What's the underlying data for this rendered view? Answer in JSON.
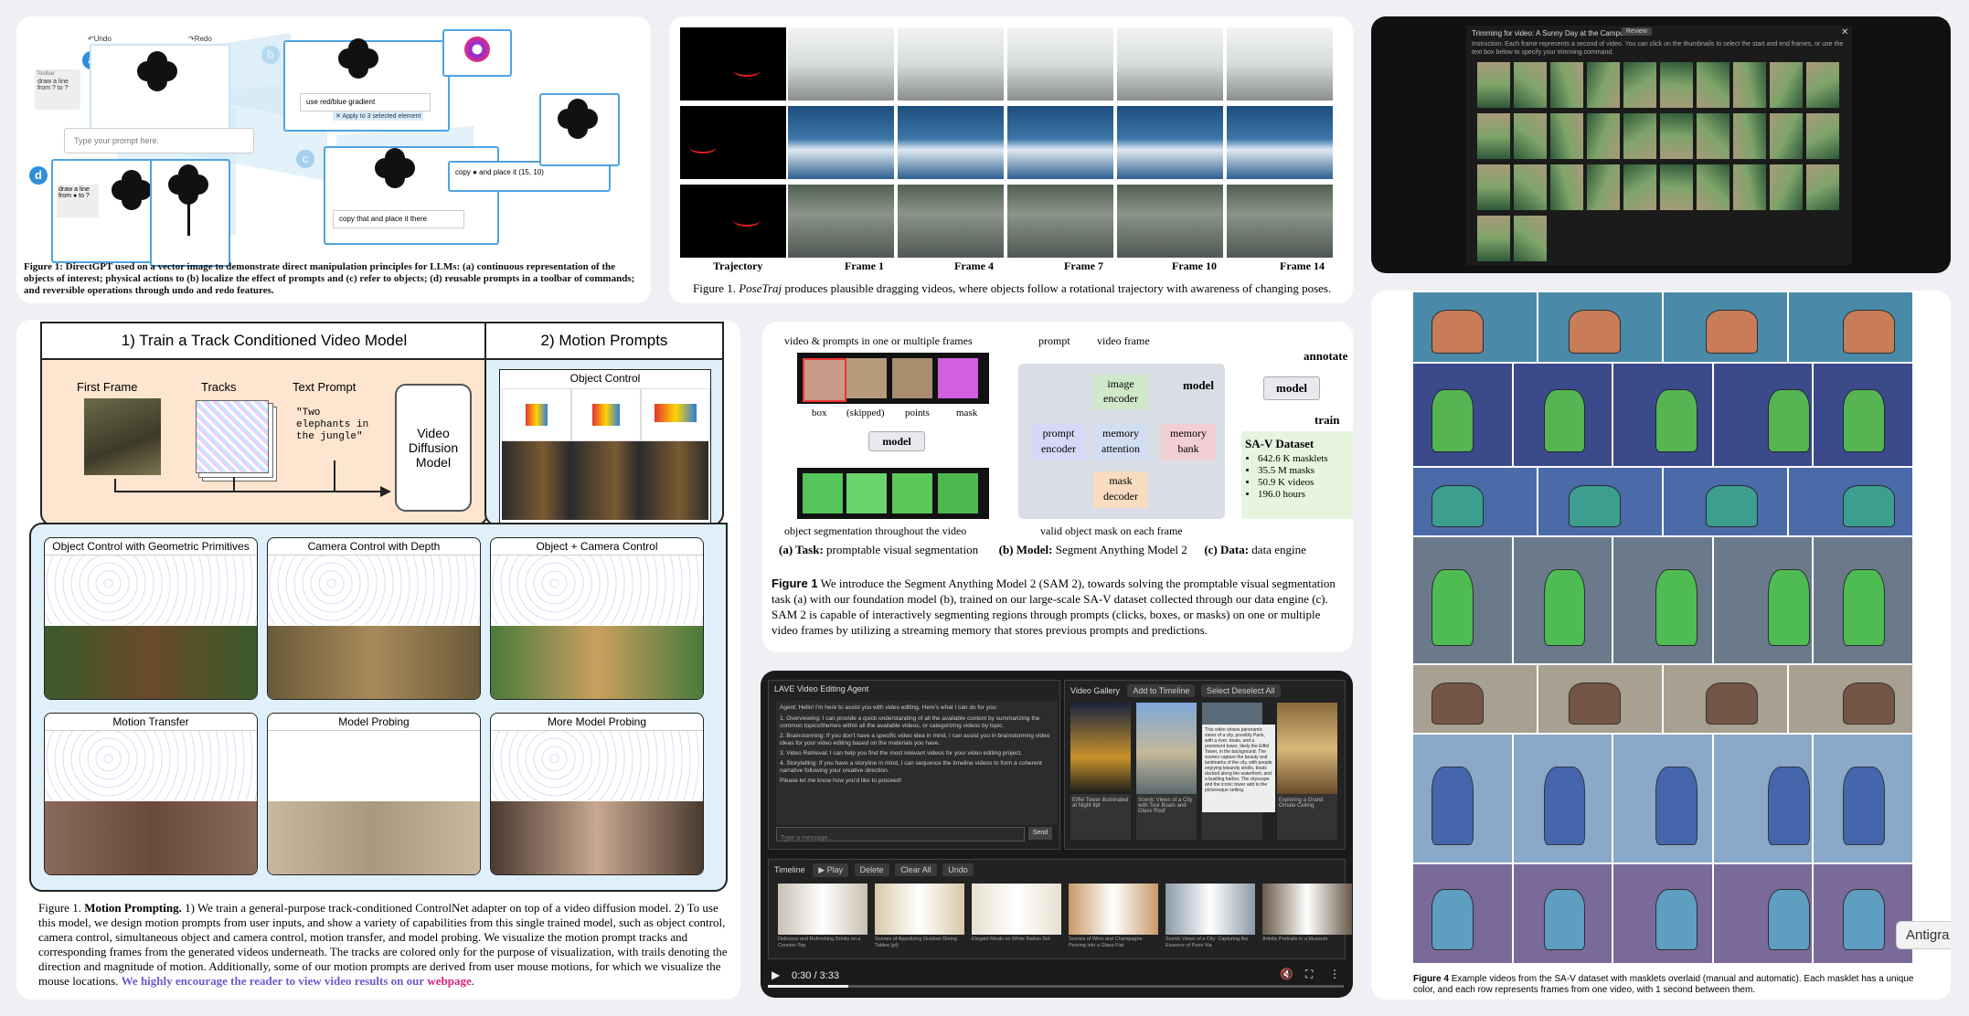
{
  "p1": {
    "undo": "↶Undo",
    "redo": "↷Redo",
    "badges": [
      "a",
      "b",
      "c",
      "d"
    ],
    "toolbar_label": "Toolbar",
    "draw_line_a": "draw a line from ? to ?",
    "draw_line_d": "draw a line from ● to ?",
    "gradient_text": "use red/blue gradient",
    "apply_text": "✕ Apply to 3 selected element",
    "prompt_placeholder": "Type your prompt here.",
    "copy_place_text": "copy ● and place it (15, 10)",
    "copy_that_text": "copy that and place it there",
    "caption": "Figure 1: DirectGPT used on a vector image to demonstrate direct manipulation principles for LLMs: (a) continuous representation of the objects of interest; physical actions to (b) localize the effect of prompts and (c) refer to objects; (d) reusable prompts in a toolbar of commands; and reversible operations through undo and redo features."
  },
  "p2": {
    "labels": [
      "Trajectory",
      "Frame 1",
      "Frame 4",
      "Frame 7",
      "Frame 10",
      "Frame 14"
    ],
    "caption_prefix": "Figure 1.",
    "caption_em": "PoseTraj",
    "caption_rest": "produces plausible dragging videos, where objects follow a rotational trajectory with awareness of changing poses."
  },
  "p3": {
    "title": "Trimming for video: A Sunny Day at the Campus Park",
    "badge": "Review",
    "instruction": "Instruction: Each frame represents a second of video. You can click on the thumbnails to select the start and end frames, or use the text box below to specify your trimming command."
  },
  "p4": {
    "sec1": "1) Train a Track Conditioned Video Model",
    "sec2": "2) Motion Prompts",
    "first_frame": "First Frame",
    "tracks": "Tracks",
    "text_prompt": "Text Prompt",
    "prompt_text": "\"Two elephants in the jungle\"",
    "model": "Video Diffusion Model",
    "object_control": "Object Control",
    "grid_titles": [
      "Object Control with Geometric Primitives",
      "Camera Control with Depth",
      "Object + Camera Control",
      "Motion Transfer",
      "Model Probing",
      "More Model Probing"
    ],
    "caption_prefix": "Figure 1.",
    "caption_bold": "Motion Prompting.",
    "caption_text": "1) We train a general-purpose track-conditioned ControlNet adapter on top of a video diffusion model. 2) To use this model, we design motion prompts from user inputs, and show a variety of capabilities from this single trained model, such as object control, camera control, simultaneous object and camera control, motion transfer, and model probing. We visualize the motion prompt tracks and corresponding frames from the generated videos underneath. The tracks are colored only for the purpose of visualization, with trails denoting the direction and magnitude of motion. Additionally, some of our motion prompts are derived from user mouse motions, for which we visualize the mouse locations.",
    "caption_link": "We highly encourage the reader to view video results on our",
    "caption_link2": "webpage",
    "caption_end": "."
  },
  "p5": {
    "top_label": "video & prompts in one or multiple frames",
    "prompt": "prompt",
    "video_frame": "video frame",
    "annotate": "annotate",
    "train": "train",
    "model_right": "model",
    "frame_labels": [
      "box",
      "(skipped)",
      "points",
      "mask"
    ],
    "model_small": "model",
    "image_encoder": "image encoder",
    "prompt_encoder": "prompt encoder",
    "memory_attention": "memory attention",
    "memory_bank": "memory bank",
    "mask_decoder": "mask decoder",
    "model_label": "model",
    "saV_title": "SA-V Dataset",
    "saV_items": [
      "642.6 K masklets",
      "35.5 M masks",
      "50.9 K videos",
      "196.0 hours"
    ],
    "bottom_left": "object segmentation throughout the video",
    "bottom_mid": "valid object mask on each frame",
    "task_a": "(a) Task:",
    "task_a2": "promptable visual segmentation",
    "task_b": "(b) Model:",
    "task_b2": "Segment Anything Model 2",
    "task_c": "(c) Data:",
    "task_c2": "data engine",
    "caption_bold": "Figure 1",
    "caption": "We introduce the Segment Anything Model 2 (SAM 2), towards solving the promptable visual segmentation task (a) with our foundation model (b), trained on our large-scale SA-V dataset collected through our data engine (c). SAM 2 is capable of interactively segmenting regions through prompts (clicks, boxes, or masks) on one or multiple video frames by utilizing a streaming memory that stores previous prompts and predictions."
  },
  "p6": {
    "agent_title": "LAVE Video Editing Agent",
    "agent_intro": "Agent: Hello! I'm here to assist you with video editing. Here's what I can do for you:",
    "agent_items": [
      "1. Overviewing: I can provide a quick understanding of all the available content by summarizing the common topics/themes within all the available videos, or categorizing videos by topic.",
      "2. Brainstorming: If you don't have a specific video idea in mind, I can assist you in brainstorming video ideas for your video editing based on the materials you have.",
      "3. Video Retrieval: I can help you find the most relevant videos for your video editing project.",
      "4. Storytelling: If you have a storyline in mind, I can sequence the timeline videos to form a coherent narrative following your creative direction."
    ],
    "agent_end": "Please let me know how you'd like to proceed!",
    "agent_input_placeholder": "Type a message...",
    "send": "Send",
    "gallery_title": "Video Gallery",
    "gallery_btn1": "Add to Timeline",
    "gallery_btn2": "Select Deselect All",
    "gallery_caps": [
      "Eiffel Tower illuminated at Night 6pt",
      "Scenic Views of a City with Tour Boats and Glass Roof",
      "",
      "Exploring a Grand Ornate Ceiling"
    ],
    "overlay_text": "This video shows panoramic views of a city, possibly Paris, with a river, boats, and a prominent tower, likely the Eiffel Tower, in the background. The scenes capture the beauty and landmarks of the city, with people enjoying leisurely strolls, boats docked along the waterfront, and a bustling harbor. The cityscape and the iconic tower add to the picturesque setting.",
    "timeline_title": "Timeline",
    "tl_btns": [
      "▶ Play",
      "Delete",
      "Clear All",
      "Undo"
    ],
    "tl_caps": [
      "Delicious and Refreshing Drinks on a Counter-Top",
      "Scenes of Appetizing Outdoor Dining Tables (pt)",
      "Elegant Meals on White Rattan Set",
      "Scenes of Wine and Champagne Pouring into a Glass Flat",
      "Scenic Views of a City: Capturing the Essence of Paris Via",
      "Artistic Portraits in a Museum"
    ],
    "time": "0:30 / 3:33"
  },
  "p7": {
    "caption_bold": "Figure 4",
    "caption": "Example videos from the SA-V dataset with masklets overlaid (manual and automatic). Each masklet has a unique color, and each row represents frames from one video, with 1 second between them.",
    "tag": "Antigra"
  }
}
